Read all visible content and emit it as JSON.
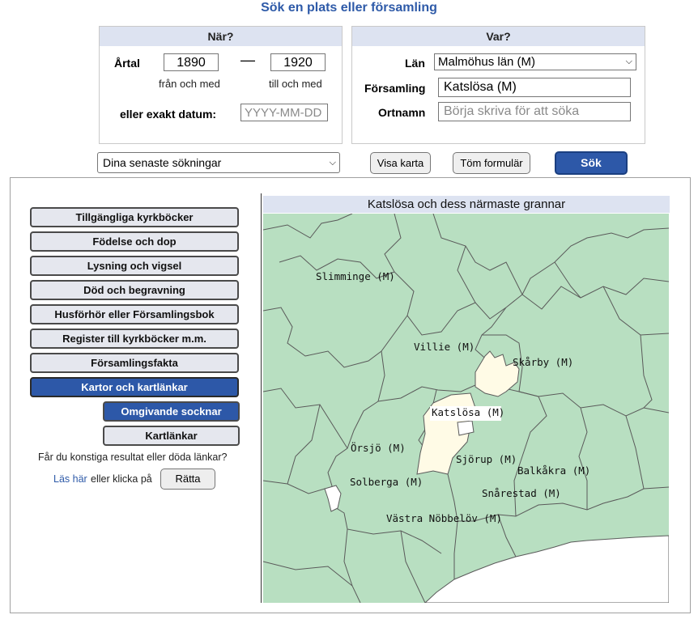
{
  "page_title": "Sök en plats eller församling",
  "when": {
    "heading": "När?",
    "year_label": "Årtal",
    "from_value": "1890",
    "from_caption": "från och med",
    "dash": "—",
    "to_value": "1920",
    "to_caption": "till och med",
    "exact_date_label": "eller exakt datum:",
    "exact_date_placeholder": "YYYY-MM-DD"
  },
  "where": {
    "heading": "Var?",
    "county_label": "Län",
    "county_value": "Malmöhus län (M)",
    "parish_label": "Församling",
    "parish_value": "Katslösa (M)",
    "place_label": "Ortnamn",
    "place_placeholder": "Börja skriva för att söka"
  },
  "toolbar": {
    "recent_searches": "Dina senaste sökningar",
    "show_map": "Visa karta",
    "clear_form": "Töm formulär",
    "search": "Sök"
  },
  "sidebar": {
    "items": [
      {
        "label": "Tillgängliga kyrkböcker",
        "active": false
      },
      {
        "label": "Födelse och dop",
        "active": false
      },
      {
        "label": "Lysning och vigsel",
        "active": false
      },
      {
        "label": "Död och begravning",
        "active": false
      },
      {
        "label": "Husförhör eller Församlingsbok",
        "active": false
      },
      {
        "label": "Register till kyrkböcker m.m.",
        "active": false
      },
      {
        "label": "Församlingsfakta",
        "active": false
      },
      {
        "label": "Kartor och kartlänkar",
        "active": true
      }
    ],
    "sub_items": [
      {
        "label": "Omgivande socknar",
        "active": true
      },
      {
        "label": "Kartlänkar",
        "active": false
      }
    ],
    "broken_links_question": "Får du konstiga resultat eller döda länkar?",
    "read_here": "Läs här",
    "or_click": "eller klicka på",
    "correct_button": "Rätta"
  },
  "map": {
    "title": "Katslösa och dess närmaste grannar",
    "labels": [
      "Slimminge (M)",
      "Villie (M)",
      "Skårby (M)",
      "Katslösa (M)",
      "Örsjö (M)",
      "Sjörup (M)",
      "Balkåkra (M)",
      "Solberga (M)",
      "Snårestad (M)",
      "Västra Nöbbelöv (M)"
    ],
    "colors": {
      "land": "#b8dfc1",
      "highlight": "#fffbe6",
      "sea": "#ffffff",
      "border": "#5a5a5a"
    }
  },
  "colors": {
    "accent": "#2d58a8",
    "panel_header": "#dde3f1",
    "title": "#2e5aa8"
  }
}
